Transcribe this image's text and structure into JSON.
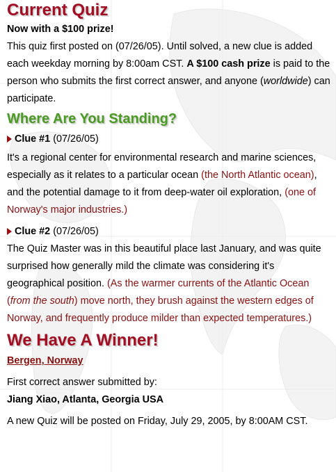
{
  "sections": {
    "current_quiz": {
      "heading": "Current Quiz",
      "subheading": "Now with a $100 prize!",
      "intro_part1": "This quiz first posted on (07/26/05). Until solved, a new clue is added each weekday morning by 8:00am CST. ",
      "intro_bold": "A $100 cash prize",
      "intro_part2": " is paid to the person who submits the first correct answer, and anyone (",
      "intro_italic": "worldwide",
      "intro_part3": ") can participate."
    },
    "standing": {
      "heading": "Where Are You Standing?"
    },
    "winner": {
      "heading": "We Have A Winner!",
      "answer_link": "Bergen, Norway",
      "submitted_label": "First correct answer submitted by:",
      "winner_name": "Jiang Xiao, Atlanta, Georgia USA",
      "next_quiz": "A new Quiz will be posted on Friday, July 29, 2005, by 8:00AM CST."
    }
  },
  "clues": [
    {
      "label": "Clue #1",
      "date": " (07/26/05)",
      "text1": "It's a regional center for environmental research and marine sciences, especially as it relates to a particular ocean ",
      "hint1": "(the North Atlantic ocean)",
      "text2": ", and the potential damage to it from deep-water oil exploration, ",
      "hint2": "(one of Norway's major industries.)"
    },
    {
      "label": "Clue #2",
      "date": " (07/26/05)",
      "text1": "The Quiz Master was in this beautiful place last January, and was quite surprised how generally mild the climate was considering it's geographical position. ",
      "hint_a": "(As the warmer currents of the Atlantic Ocean (",
      "hint_italic": "from the south",
      "hint_b": ") move north, they brush against the western edges of Norway, and frequently produce milder than expected temperatures.)"
    }
  ]
}
